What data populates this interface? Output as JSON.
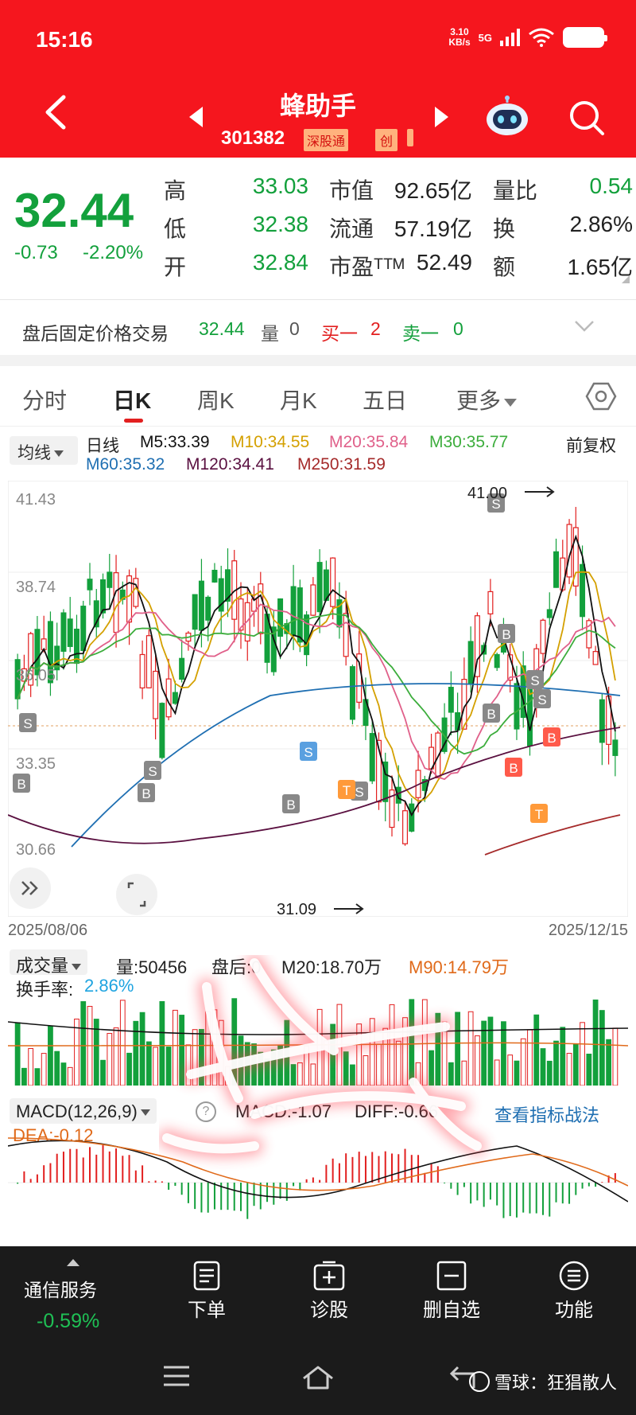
{
  "status": {
    "time": "15:16",
    "net_speed": "3.10",
    "net_unit": "KB/s",
    "network": "5G"
  },
  "header": {
    "title": "蜂助手",
    "code": "301382",
    "tag_sgt": "深股通",
    "tag_chuang": "创"
  },
  "quote": {
    "price": "32.44",
    "change": "-0.73",
    "change_pct": "-2.20%",
    "rows": [
      {
        "l1": "高",
        "v1": "33.03",
        "l2": "市值",
        "v2": "92.65亿",
        "l3": "量比",
        "v3": "0.54"
      },
      {
        "l1": "低",
        "v1": "32.38",
        "l2": "流通",
        "v2": "57.19亿",
        "l3": "换",
        "v3": "2.86%"
      },
      {
        "l1": "开",
        "v1": "32.84",
        "l2": "市盈ᵀᵀᴹ",
        "v2": "52.49",
        "l3": "额",
        "v3": "1.65亿"
      }
    ]
  },
  "after_hours": {
    "label": "盘后固定价格交易",
    "price": "32.44",
    "vol_label": "量",
    "vol": "0",
    "buy_label": "买一",
    "buy": "2",
    "sell_label": "卖一",
    "sell": "0"
  },
  "tabs": [
    "分时",
    "日K",
    "周K",
    "月K",
    "五日",
    "更多"
  ],
  "ma": {
    "button": "均线",
    "label": "日线",
    "adjust": "前复权",
    "items": [
      {
        "text": "M5:33.39",
        "color": "#111111"
      },
      {
        "text": "M10:34.55",
        "color": "#d4a000"
      },
      {
        "text": "M20:35.84",
        "color": "#e0608a"
      },
      {
        "text": "M30:35.77",
        "color": "#3cad3c"
      },
      {
        "text": "M60:35.32",
        "color": "#1f6fb2"
      },
      {
        "text": "M120:34.41",
        "color": "#5a1040"
      },
      {
        "text": "M250:31.59",
        "color": "#a52a2a"
      }
    ]
  },
  "chart_data": {
    "type": "candlestick",
    "y_ticks": [
      "41.43",
      "38.74",
      "36.05",
      "33.35",
      "30.66"
    ],
    "ylim": [
      30.66,
      41.43
    ],
    "high_label": "41.00",
    "low_label": "31.09",
    "start_date": "2025/08/06",
    "end_date": "2025/12/15",
    "last_close": 32.44
  },
  "volume": {
    "button": "成交量",
    "vol": "量:50456",
    "after": "盘后:0",
    "m20": "M20:18.70万",
    "m90": "M90:14.79万",
    "turnover_label": "换手率:",
    "turnover": "2.86%"
  },
  "macd": {
    "button": "MACD(12,26,9)",
    "help": "?",
    "macd": "MACD:-1.07",
    "diff": "DIFF:-0.66",
    "dea": "DEA:-0.12",
    "link": "查看指标战法"
  },
  "actionbar": {
    "industry": "通信服务",
    "industry_chg": "-0.59%",
    "items": [
      "下单",
      "诊股",
      "删自选",
      "功能"
    ]
  },
  "watermark": "雪球：狂猖散人",
  "colors": {
    "brand_red": "#f5161e",
    "up_red": "#e21f1f",
    "down_green": "#13a03c"
  }
}
